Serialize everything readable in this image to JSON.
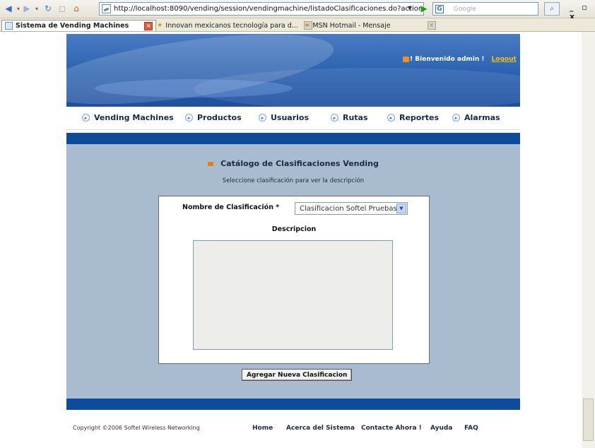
{
  "browser": {
    "url": "http://localhost:8090/vending/session/vendingmachine/listadoClasificaciones.do?action=listado",
    "search_placeholder": "Google",
    "tabs": [
      {
        "label": "Sistema de Vending Machines",
        "active": true
      },
      {
        "label": "Innovan mexicanos tecnología para d...",
        "active": false
      },
      {
        "label": "MSN Hotmail - Mensaje",
        "active": false
      }
    ]
  },
  "header": {
    "welcome": "! Bienvenido admin !",
    "logout": "Logout"
  },
  "nav": {
    "items": [
      {
        "label": "Vending Machines"
      },
      {
        "label": "Productos"
      },
      {
        "label": "Usuarios"
      },
      {
        "label": "Rutas"
      },
      {
        "label": "Reportes"
      },
      {
        "label": "Alarmas"
      }
    ]
  },
  "main": {
    "title": "Catálogo de Clasificaciones Vending",
    "subtitle": "Seleccione clasificación para ver la descripción",
    "field_label": "Nombre de Clasificación *",
    "select_value": "Clasificacion Softel Pruebas",
    "description_label": "Descripcion",
    "description_value": "",
    "add_button": "Agregar Nueva Clasificacion"
  },
  "footer": {
    "copyright": "Copyright ©2006 Softel Wireless Networking",
    "links": [
      "Home",
      "Acerca del Sistema",
      "Contacte Ahora !",
      "Ayuda",
      "FAQ"
    ]
  },
  "colors": {
    "band": "#0e4c9b",
    "content_bg": "#a9bccf",
    "accent": "#ef7a1c"
  }
}
